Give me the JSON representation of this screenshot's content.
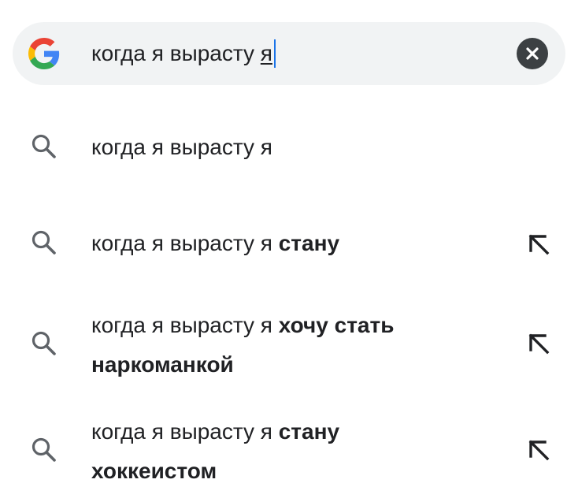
{
  "search": {
    "query": "когда я вырасту ",
    "query_current_word": "я"
  },
  "suggestions": [
    {
      "plain": "когда я вырасту я",
      "bold": ""
    },
    {
      "plain": "когда я вырасту я ",
      "bold": "стану"
    },
    {
      "plain": "когда я вырасту я ",
      "bold": "хочу стать наркоманкой"
    },
    {
      "plain": "когда я вырасту я ",
      "bold": "стану хоккеистом"
    }
  ],
  "icons": {
    "logo": "google-g-icon",
    "clear": "close-circle-icon",
    "suggestion": "search-icon",
    "fill": "north-west-arrow-icon"
  },
  "colors": {
    "search_bg": "#f1f3f4",
    "caret": "#1a73e8",
    "text": "#202124",
    "icon_gray": "#5f6368"
  }
}
